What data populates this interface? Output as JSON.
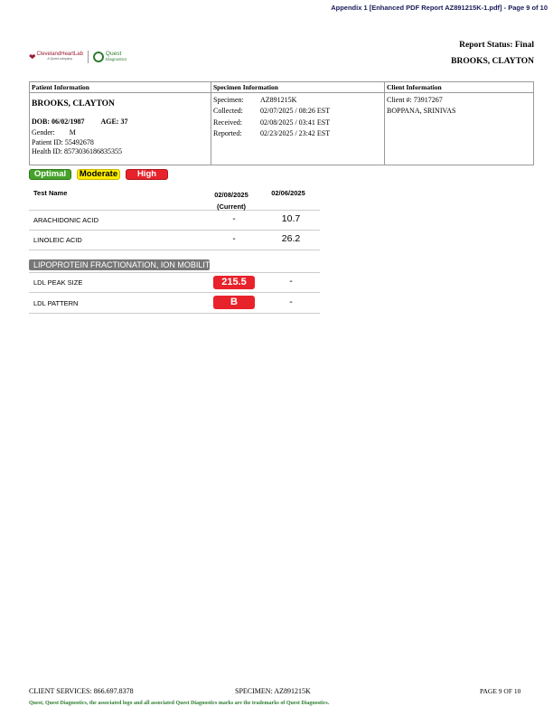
{
  "appendix_header": "Appendix 1 [Enhanced PDF Report AZ891215K-1.pdf] - Page 9 of 10",
  "logos": {
    "cleveland": "ClevelandHeartLab",
    "cleveland_sub": "A Quest company",
    "quest": "Quest",
    "quest_sub": "Diagnostics"
  },
  "report_status": "Report Status: Final",
  "patient_name_header": "BROOKS, CLAYTON",
  "patient": {
    "title": "Patient Information",
    "name": "BROOKS, CLAYTON",
    "dob": "DOB: 06/02/1987",
    "age": "AGE: 37",
    "gender_label": "Gender:",
    "gender": "M",
    "id_label": "Patient ID:",
    "id": "55492678",
    "health_label": "Health ID:",
    "health": "8573036186835355"
  },
  "specimen": {
    "title": "Specimen Information",
    "rows": [
      {
        "label": "Specimen:",
        "value": "AZ891215K"
      },
      {
        "label": "Collected:",
        "value": "02/07/2025  / 08:26 EST"
      },
      {
        "label": "Received:",
        "value": "02/08/2025  / 03:41 EST"
      },
      {
        "label": "Reported:",
        "value": "02/23/2025  / 23:42 EST"
      }
    ]
  },
  "client": {
    "title": "Client Information",
    "number": "Client #: 73917267",
    "physician": "BOPPANA, SRINIVAS"
  },
  "legend": {
    "optimal": "Optimal",
    "moderate": "Moderate",
    "high": "High"
  },
  "results": {
    "col_test": "Test Name",
    "col_date1": "02/08/2025",
    "col_date1_sub": "(Current)",
    "col_date2": "02/06/2025",
    "rows": [
      {
        "name": "ARACHIDONIC ACID",
        "current": "-",
        "previous": "10.7"
      },
      {
        "name": "LINOLEIC ACID",
        "current": "-",
        "previous": "26.2"
      }
    ],
    "section": "LIPOPROTEIN FRACTIONATION, ION MOBILITY",
    "section_rows": [
      {
        "name": "LDL PEAK SIZE",
        "current": "215.5",
        "previous": "-"
      },
      {
        "name": "LDL PATTERN",
        "current": "B",
        "previous": "-"
      }
    ]
  },
  "footer": {
    "client_services": "CLIENT SERVICES: 866.697.8378",
    "specimen": "SPECIMEN: AZ891215K",
    "page": "PAGE 9 OF 10",
    "trademark": "Quest, Quest Diagnostics, the associated logo and all associated Quest Diagnostics marks are the trademarks of Quest Diagnostics."
  },
  "colors": {
    "optimal": "#46a22a",
    "moderate": "#ffec00",
    "high": "#e8222b",
    "section_bar": "#777777"
  }
}
